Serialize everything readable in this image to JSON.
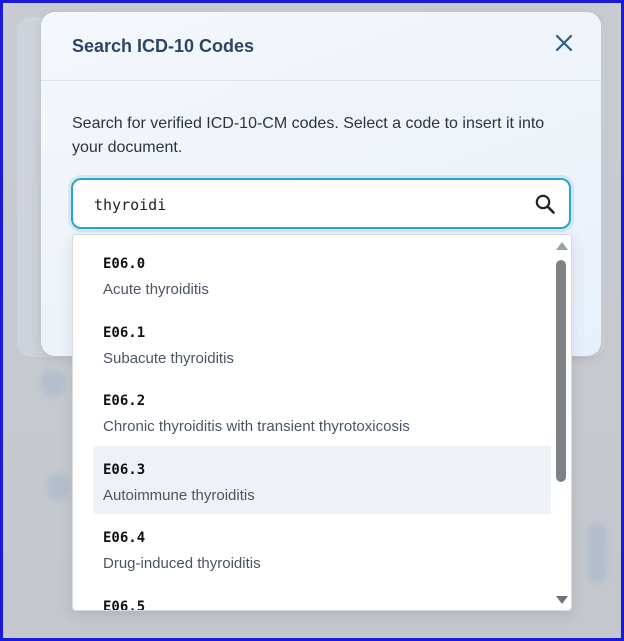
{
  "modal": {
    "title": "Search ICD-10 Codes",
    "description": "Search for verified ICD-10-CM codes. Select a code to insert it into your document.",
    "close_icon": "close-icon"
  },
  "search": {
    "value": "thyroidi",
    "icon": "search-icon"
  },
  "results": [
    {
      "code": "E06.0",
      "description": "Acute thyroiditis"
    },
    {
      "code": "E06.1",
      "description": "Subacute thyroiditis"
    },
    {
      "code": "E06.2",
      "description": "Chronic thyroiditis with transient thyrotoxicosis"
    },
    {
      "code": "E06.3",
      "description": "Autoimmune thyroiditis"
    },
    {
      "code": "E06.4",
      "description": "Drug-induced thyroiditis"
    },
    {
      "code": "E06.5",
      "description": ""
    }
  ],
  "highlighted_index": 3,
  "colors": {
    "accent": "#2aa6c9",
    "title": "#2e4566",
    "highlight": "#eef2f8"
  }
}
